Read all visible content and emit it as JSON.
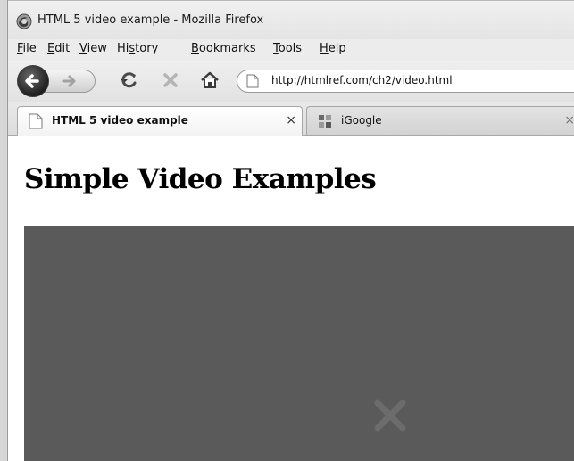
{
  "window": {
    "title": "HTML 5 video example - Mozilla Firefox",
    "icon": "firefox-icon"
  },
  "menubar": {
    "items": [
      {
        "label": "File",
        "accesskey": "F"
      },
      {
        "label": "Edit",
        "accesskey": "E"
      },
      {
        "label": "View",
        "accesskey": "V"
      },
      {
        "label": "History",
        "accesskey": "s"
      },
      {
        "label": "Bookmarks",
        "accesskey": "B"
      },
      {
        "label": "Tools",
        "accesskey": "T"
      },
      {
        "label": "Help",
        "accesskey": "H"
      }
    ]
  },
  "navbar": {
    "back_icon": "back-arrow-icon",
    "forward_icon": "forward-arrow-icon",
    "history_dropdown_icon": "chevron-down-icon",
    "reload_icon": "reload-icon",
    "stop_icon": "stop-icon",
    "home_icon": "home-icon",
    "url": "http://htmlref.com/ch2/video.html"
  },
  "tabs": [
    {
      "label": "HTML 5 video example",
      "icon": "page-icon",
      "active": true,
      "close": "×"
    },
    {
      "label": "iGoogle",
      "icon": "igoogle-icon",
      "active": false,
      "close": "×"
    }
  ],
  "page": {
    "heading": "Simple Video Examples",
    "video": {
      "state": "error",
      "icon": "video-error-x-icon",
      "background_color": "#5a5a5a"
    }
  },
  "colors": {
    "chrome_background": "#e6e6e6",
    "content_background": "#ffffff",
    "video_background": "#5a5a5a"
  }
}
